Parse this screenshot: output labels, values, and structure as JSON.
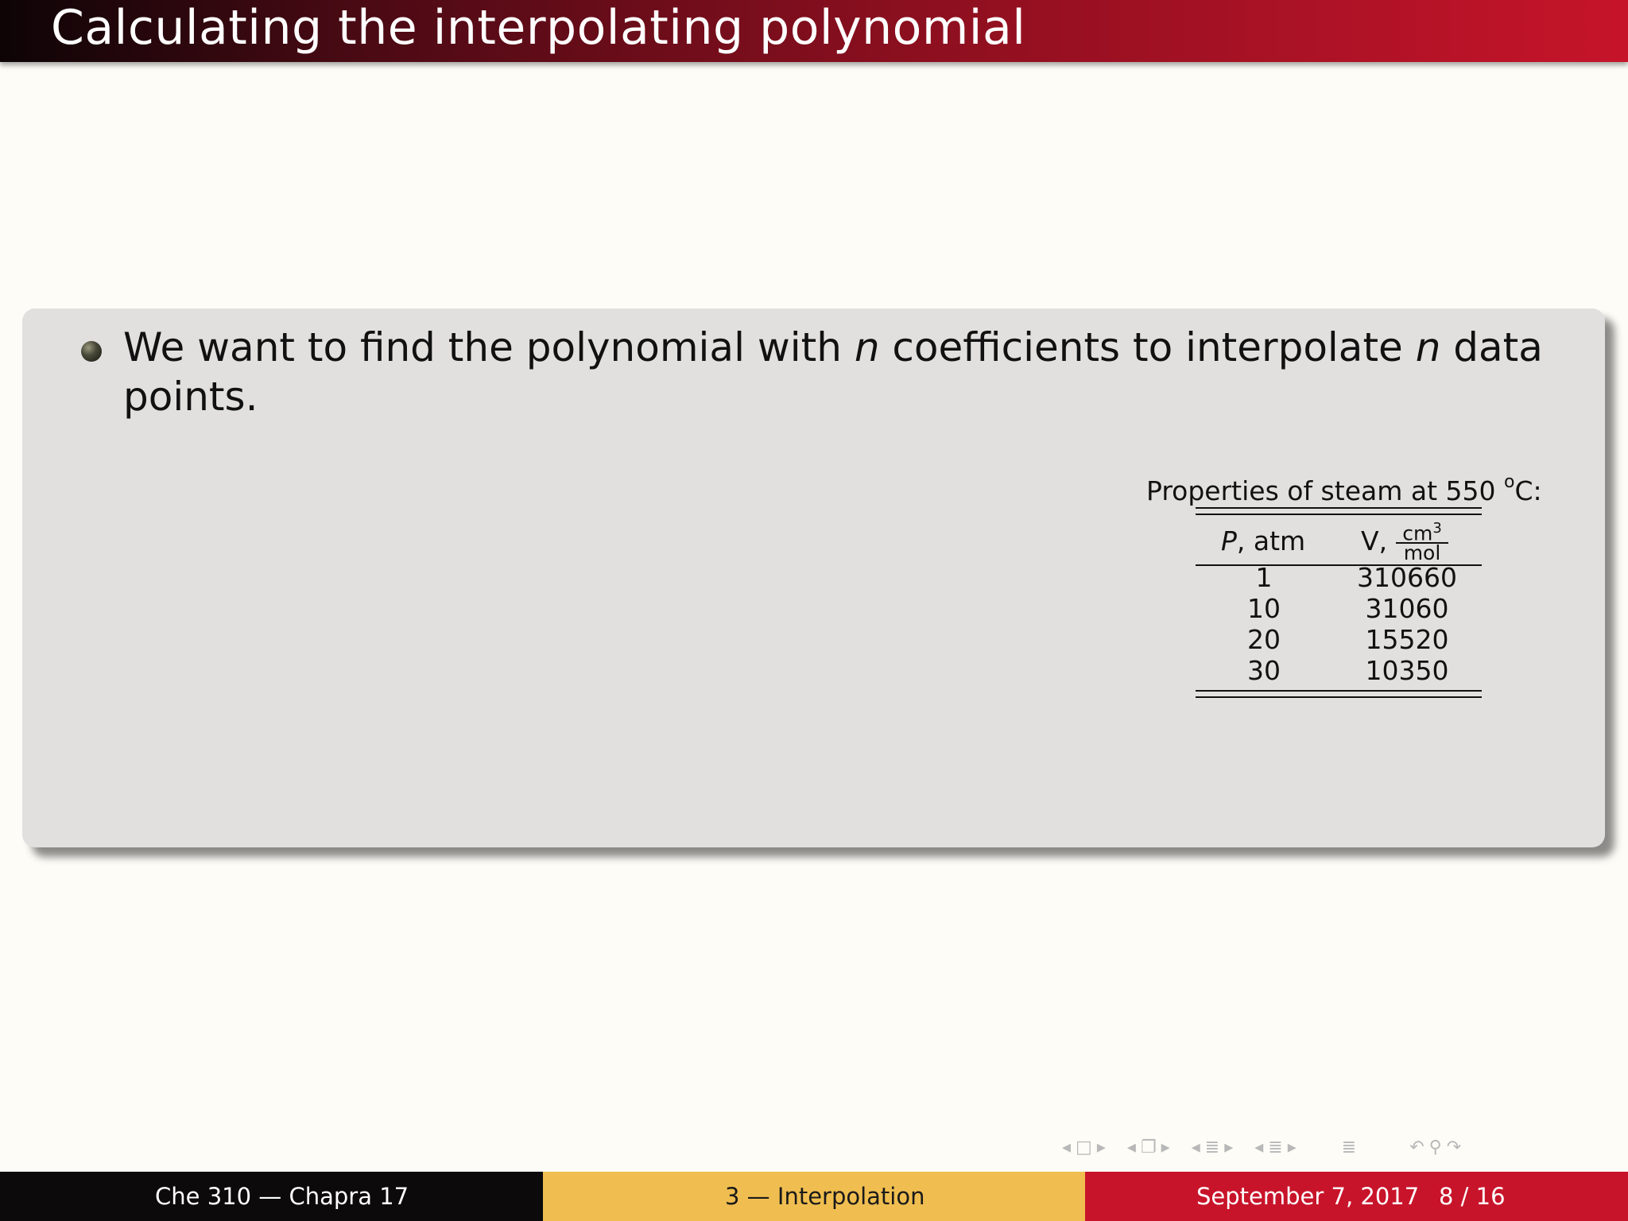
{
  "slide": {
    "title": "Calculating the interpolating polynomial",
    "bullet": {
      "part1": "We want to find the polynomial with ",
      "var1": "n",
      "part2": " coefficients to interpolate ",
      "var2": "n",
      "part3": " data points."
    }
  },
  "table": {
    "caption": "Properties of steam at 550",
    "caption_degree": "o",
    "caption_unit": "C:",
    "col_p_var": "P",
    "col_p_unit": ", atm",
    "col_v": "V,",
    "col_v_num": "cm",
    "col_v_num_exp": "3",
    "col_v_den": "mol",
    "rows": [
      {
        "p": "1",
        "v": "310660"
      },
      {
        "p": "10",
        "v": "31060"
      },
      {
        "p": "20",
        "v": "15520"
      },
      {
        "p": "30",
        "v": "10350"
      }
    ]
  },
  "footer": {
    "left": "Che 310 — Chapra 17",
    "center": "3 — Interpolation",
    "date": "September 7, 2017",
    "page": "8 / 16"
  },
  "nav_icons": [
    "nav-prev-frame",
    "nav-frame",
    "nav-next-frame",
    "nav-prev-subsection",
    "nav-subsection",
    "nav-next-subsection",
    "nav-prev-section",
    "nav-section",
    "nav-next-section",
    "nav-prev-part",
    "nav-part",
    "nav-next-part",
    "nav-toc",
    "nav-back",
    "nav-search",
    "nav-forward"
  ],
  "colors": {
    "title_gradient_start": "#0d0406",
    "title_gradient_end": "#c6142a",
    "block_bg": "#e2e0df",
    "footer_left": "#0c0a0a",
    "footer_center": "#f0be50",
    "footer_right": "#c8142a"
  }
}
